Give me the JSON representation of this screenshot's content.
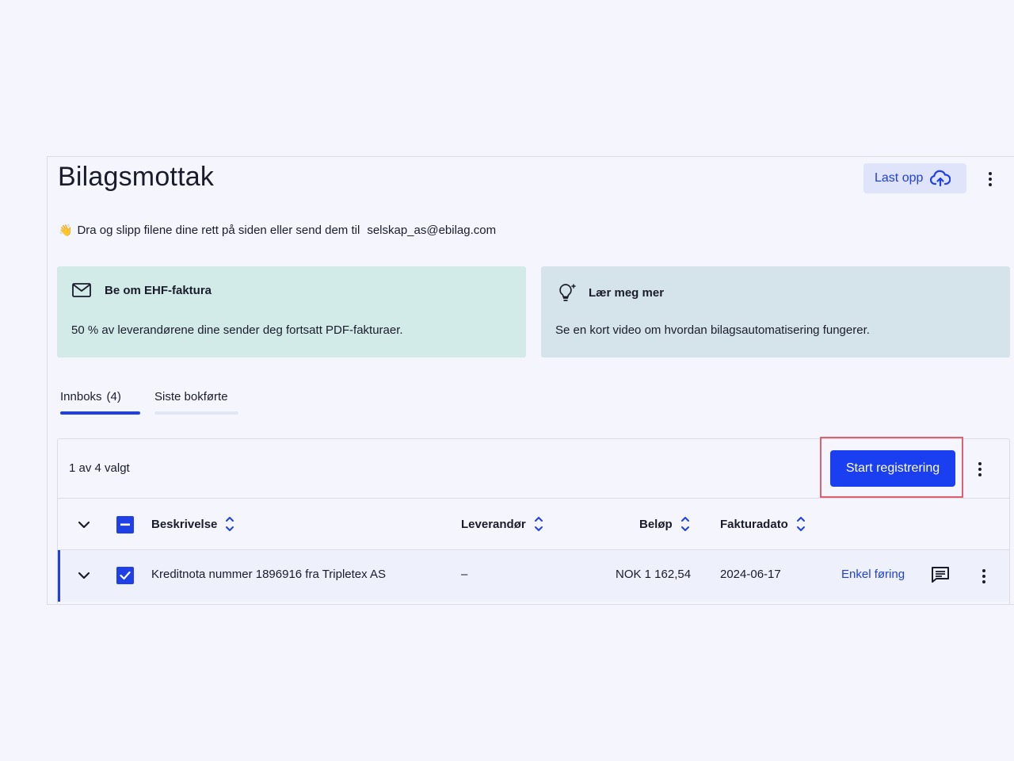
{
  "header": {
    "title": "Bilagsmottak",
    "upload_label": "Last opp"
  },
  "drop_hint": {
    "emoji": "👋",
    "text": "Dra og slipp filene dine rett på siden eller send dem til",
    "email": "selskap_as@ebilag.com"
  },
  "cards": [
    {
      "title": "Be om EHF-faktura",
      "text": "50 % av leverandørene dine sender deg fortsatt PDF-fakturaer.",
      "icon": "mail-icon"
    },
    {
      "title": "Lær meg mer",
      "text": "Se en kort video om hvordan bilagsautomatisering fungerer.",
      "icon": "lightbulb-icon"
    }
  ],
  "tabs": [
    {
      "label": "Innboks",
      "count": "(4)",
      "active": true
    },
    {
      "label": "Siste bokførte",
      "active": false
    }
  ],
  "table": {
    "selection_text": "1 av 4 valgt",
    "primary_action": "Start registrering",
    "columns": [
      "Beskrivelse",
      "Leverandør",
      "Beløp",
      "Fakturadato"
    ],
    "rows": [
      {
        "description": "Kreditnota nummer 1896916 fra Tripletex AS",
        "supplier": "–",
        "amount": "NOK 1 162,54",
        "date": "2024-06-17",
        "action": "Enkel føring",
        "checked": true
      }
    ]
  },
  "colors": {
    "accent": "#1e40e6",
    "button": "#1a3ff0",
    "card_green": "#d3ebe8",
    "card_blue": "#d5e3ea",
    "highlight": "#e06070"
  }
}
